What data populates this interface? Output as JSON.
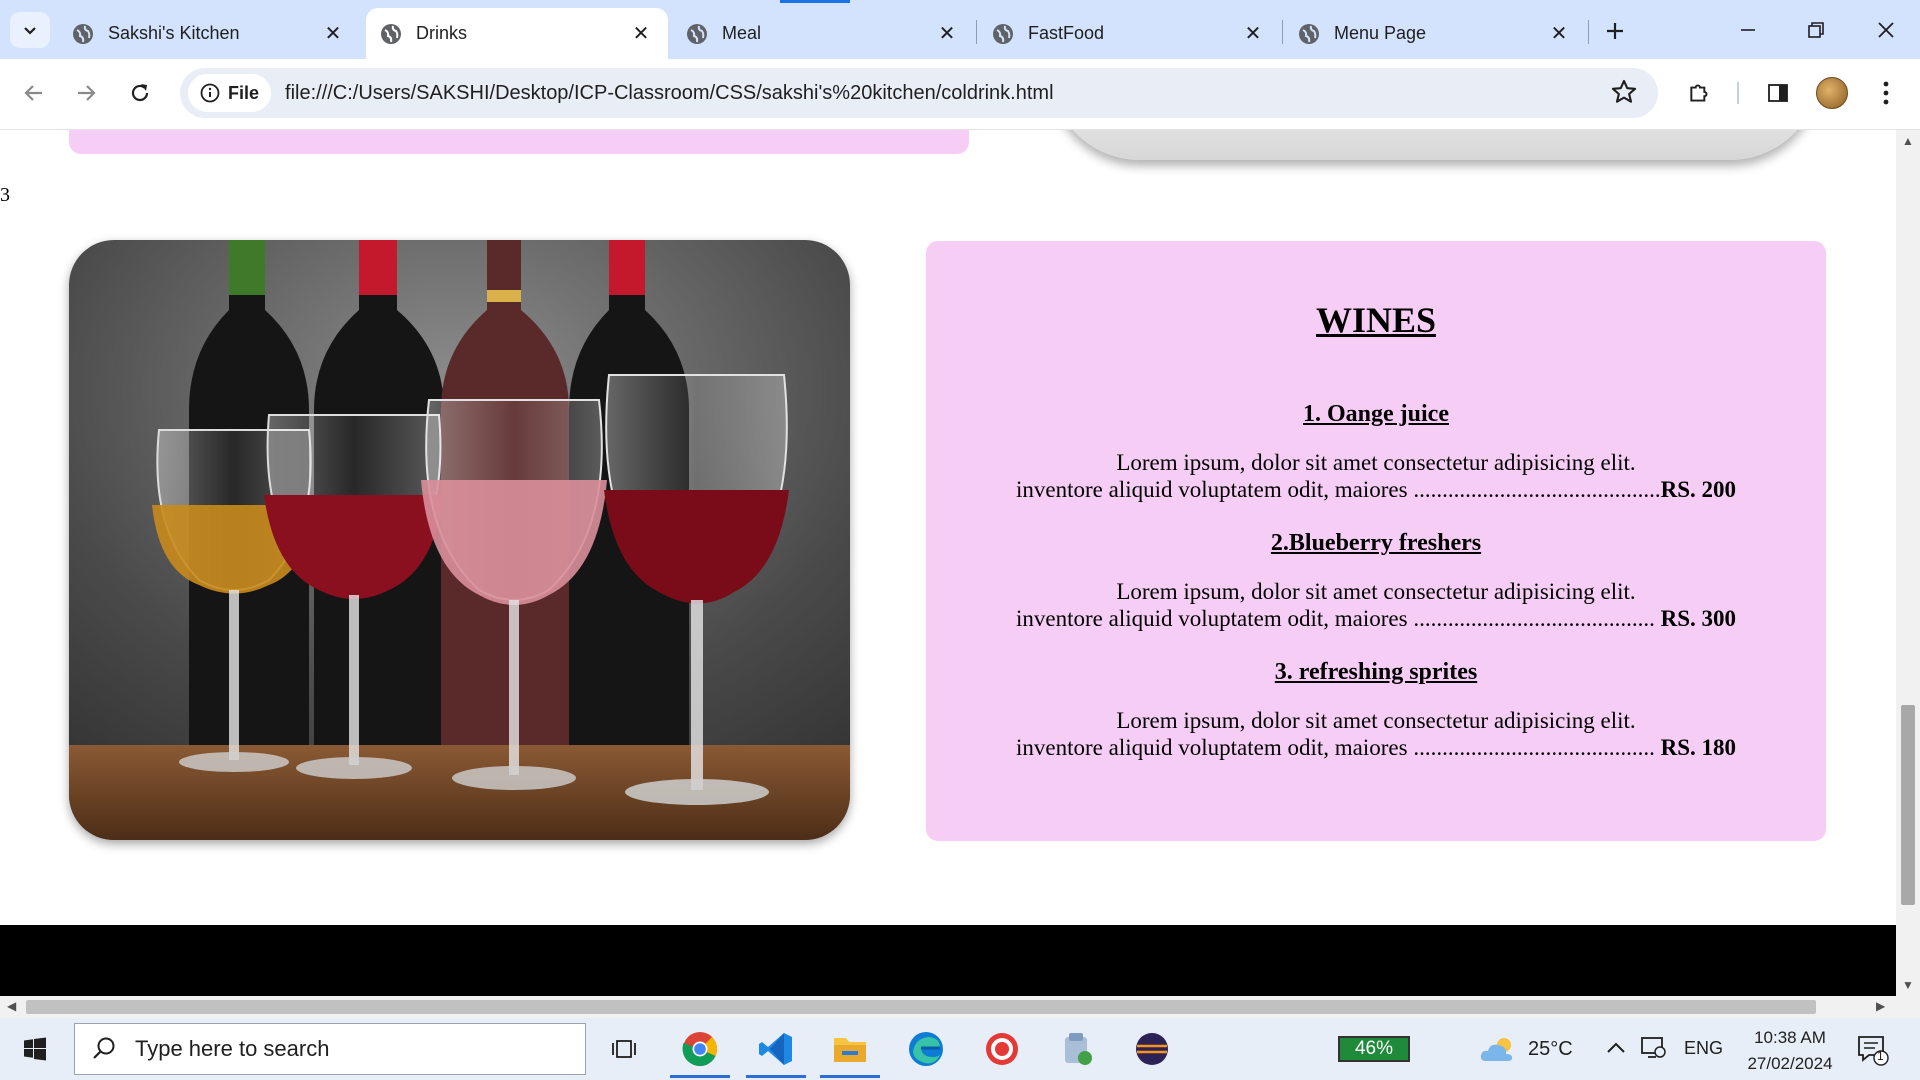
{
  "browser": {
    "tabs": [
      {
        "title": "Sakshi's Kitchen",
        "active": false
      },
      {
        "title": "Drinks",
        "active": true
      },
      {
        "title": "Meal",
        "active": false
      },
      {
        "title": "FastFood",
        "active": false
      },
      {
        "title": "Menu Page",
        "active": false
      }
    ],
    "address": {
      "chip_label": "File",
      "url": "file:///C:/Users/SAKSHI/Desktop/ICP-Classroom/CSS/sakshi's%20kitchen/coldrink.html"
    }
  },
  "page": {
    "section_number": "3",
    "image_alt": "Four glasses of wine in front of wine bottles",
    "menu": {
      "title": "WINES",
      "items": [
        {
          "name": "1. Oange juice",
          "desc_line1": "Lorem ipsum, dolor sit amet consectetur adipisicing elit.",
          "desc_line2": "inventore aliquid voluptatem odit, maiores ...........................................",
          "price": "RS. 200"
        },
        {
          "name": "2.Blueberry freshers",
          "desc_line1": "Lorem ipsum, dolor sit amet consectetur adipisicing elit.",
          "desc_line2": "inventore aliquid voluptatem odit, maiores ..........................................",
          "price": "RS. 300"
        },
        {
          "name": "3. refreshing sprites",
          "desc_line1": "Lorem ipsum, dolor sit amet consectetur adipisicing elit.",
          "desc_line2": "inventore aliquid voluptatem odit, maiores ..........................................",
          "price": "RS. 180"
        }
      ]
    },
    "colors": {
      "card_bg": "#f6cdf5",
      "footer_bg": "#000000"
    }
  },
  "taskbar": {
    "search_placeholder": "Type here to search",
    "battery": "46%",
    "temperature": "25°C",
    "language": "ENG",
    "time": "10:38 AM",
    "date": "27/02/2024",
    "notification_count": "1"
  }
}
